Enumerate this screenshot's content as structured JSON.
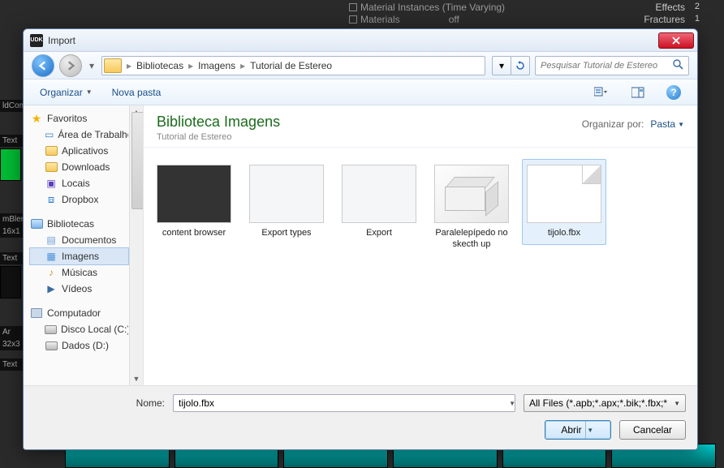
{
  "bg": {
    "items": [
      {
        "label": "Material Instances (Time Varying)"
      },
      {
        "label": "Materials"
      }
    ],
    "offLabel": "off",
    "right": [
      {
        "label": "Effects",
        "count": "2"
      },
      {
        "label": "Fractures",
        "count": "1"
      }
    ],
    "leftLabels": [
      "ldCom",
      "Text",
      "mBler",
      "16x1",
      "Text",
      "Ar",
      "32x3",
      "Text"
    ]
  },
  "dialog": {
    "title": "Import",
    "breadcrumb": [
      "Bibliotecas",
      "Imagens",
      "Tutorial de Estereo"
    ],
    "searchPlaceholder": "Pesquisar Tutorial de Estereo"
  },
  "toolbar": {
    "organize": "Organizar",
    "newFolder": "Nova pasta"
  },
  "sidebar": {
    "favorites": {
      "label": "Favoritos",
      "items": [
        "Área de Trabalho",
        "Aplicativos",
        "Downloads",
        "Locais",
        "Dropbox"
      ]
    },
    "libraries": {
      "label": "Bibliotecas",
      "items": [
        "Documentos",
        "Imagens",
        "Músicas",
        "Vídeos"
      ],
      "selectedIndex": 1
    },
    "computer": {
      "label": "Computador",
      "items": [
        "Disco Local (C:)",
        "Dados (D:)"
      ]
    }
  },
  "main": {
    "libTitle": "Biblioteca Imagens",
    "libSub": "Tutorial de Estereo",
    "arrangeLabel": "Organizar por:",
    "arrangeValue": "Pasta",
    "files": [
      {
        "name": "content browser",
        "kind": "screenshot"
      },
      {
        "name": "Export types",
        "kind": "win"
      },
      {
        "name": "Export",
        "kind": "win2"
      },
      {
        "name": "Paralelepípedo no skecth up",
        "kind": "box3d"
      },
      {
        "name": "tijolo.fbx",
        "kind": "page",
        "selected": true
      }
    ]
  },
  "bottom": {
    "nameLabel": "Nome:",
    "nameValue": "tijolo.fbx",
    "filter": "All Files (*.apb;*.apx;*.bik;*.fbx;*",
    "open": "Abrir",
    "cancel": "Cancelar"
  }
}
